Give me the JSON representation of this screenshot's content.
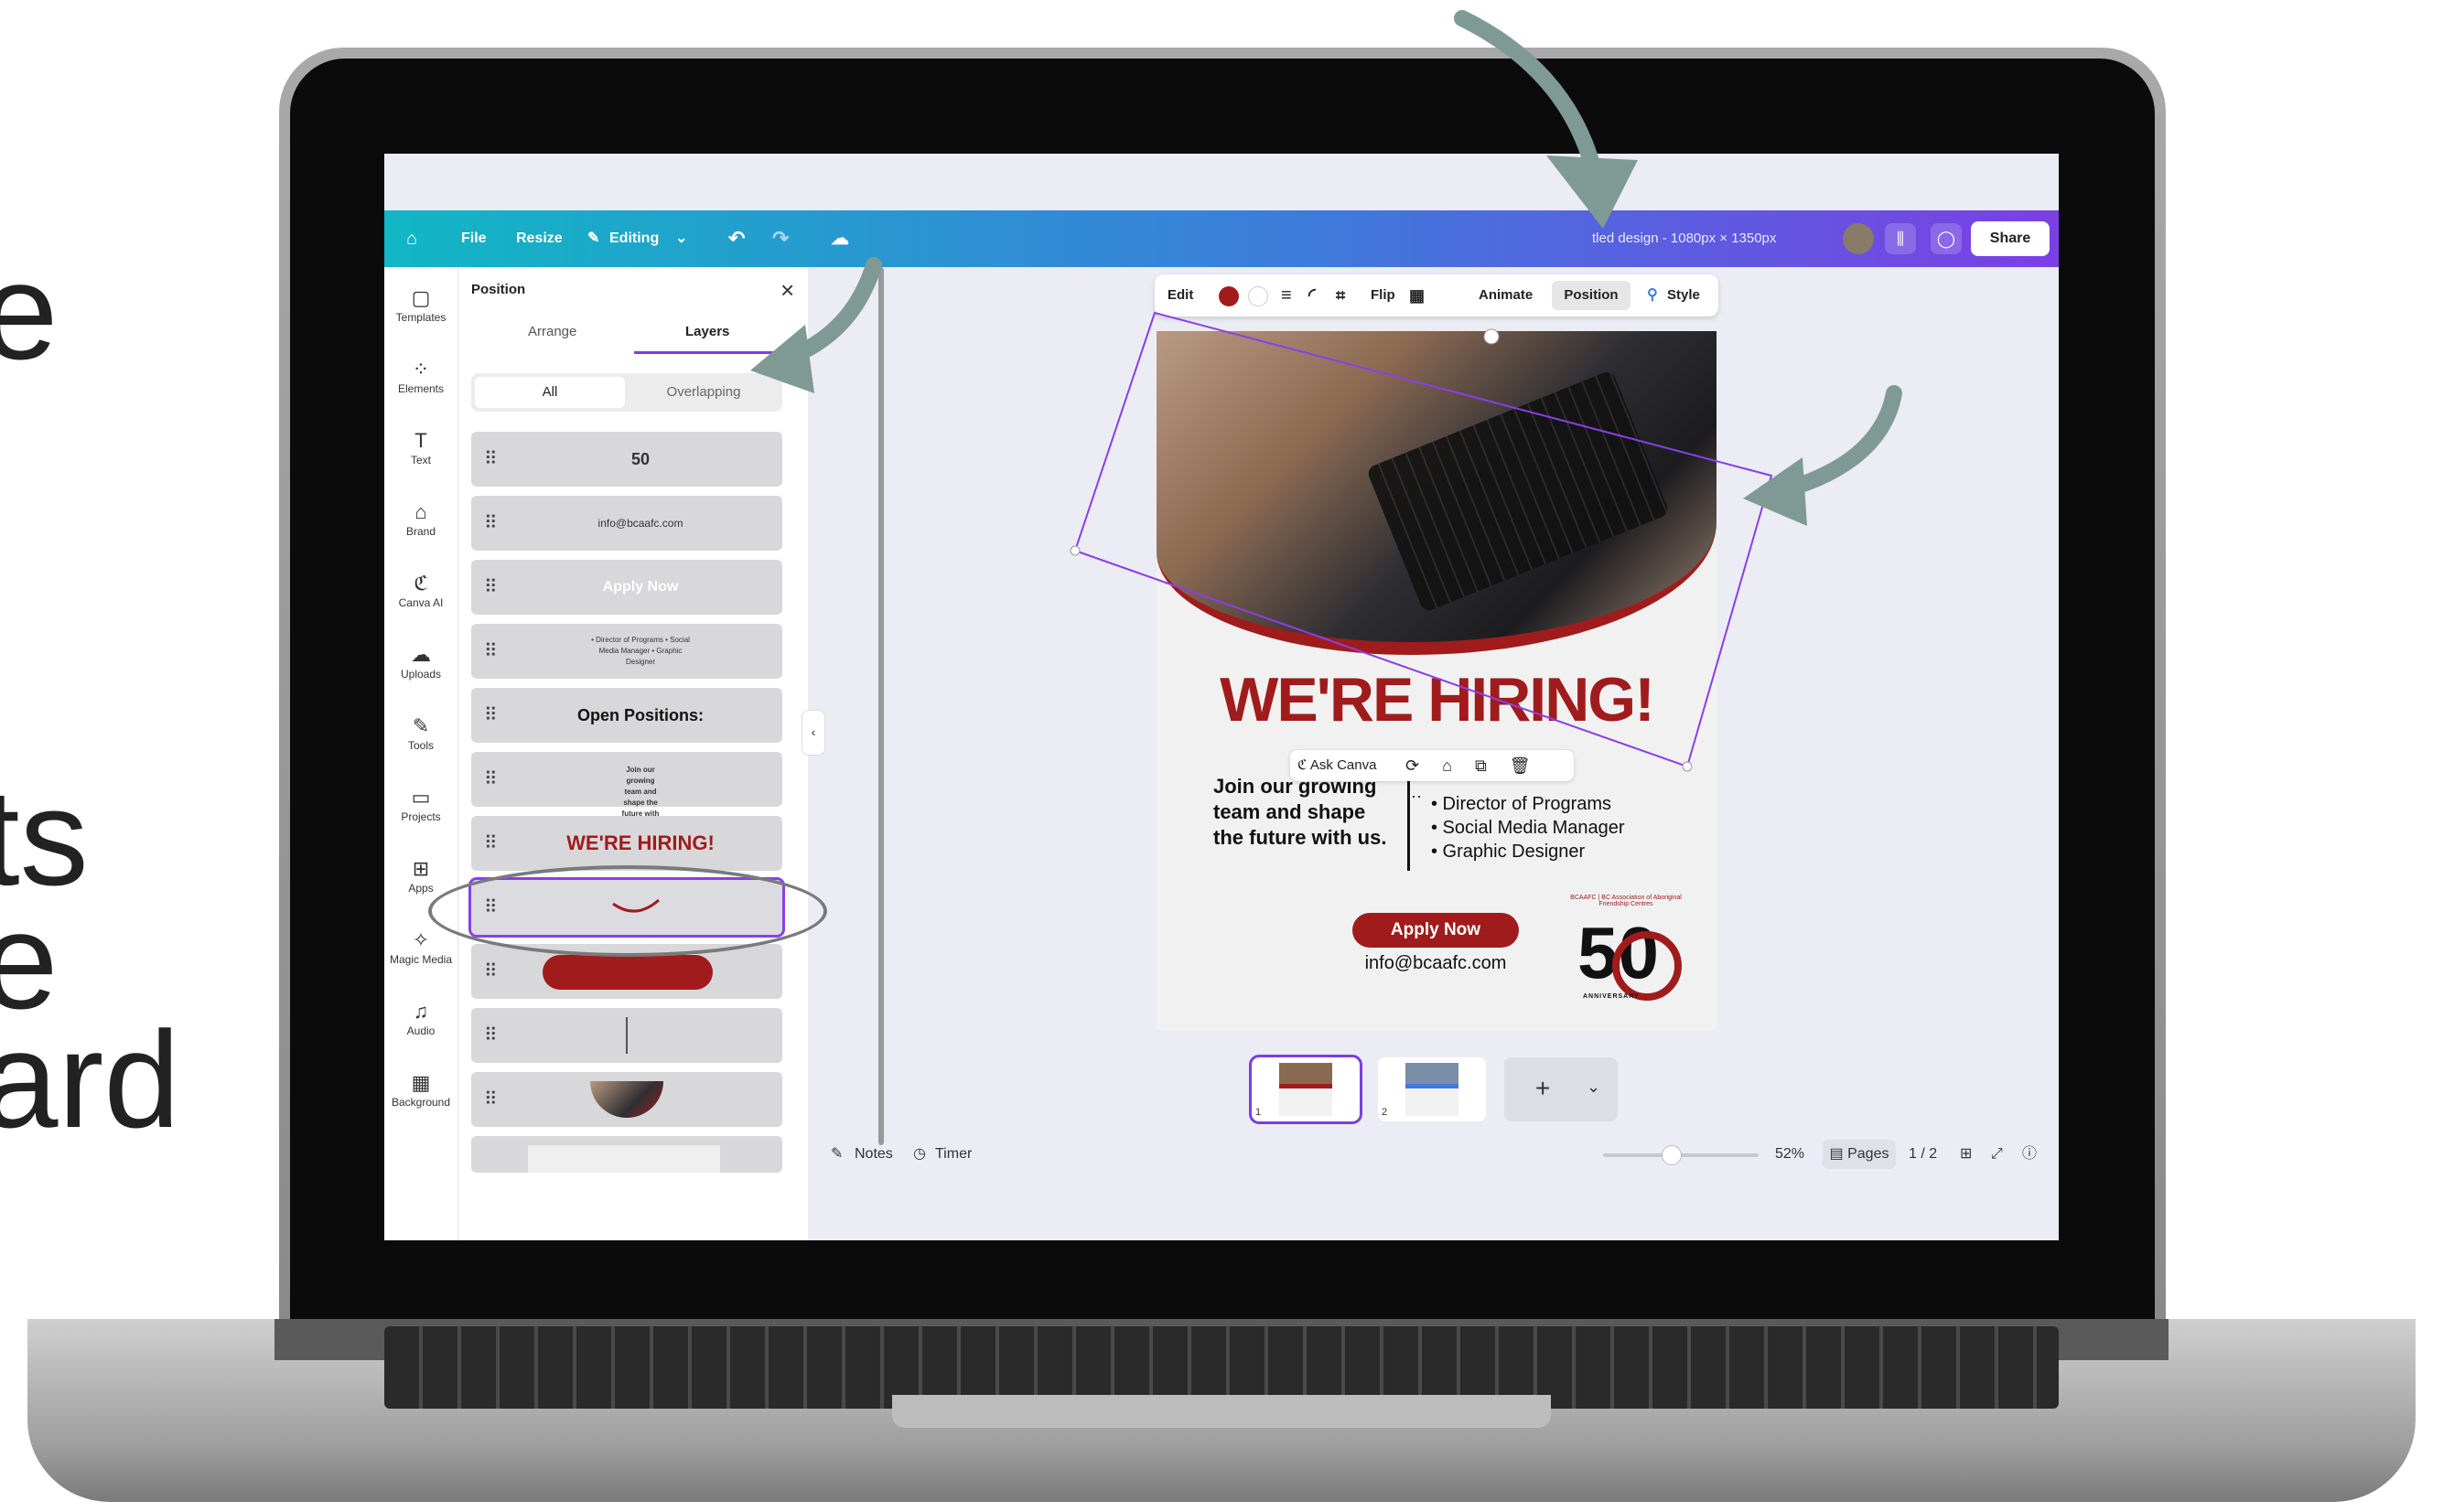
{
  "background_text": [
    "e",
    "ts",
    "e",
    "ard"
  ],
  "topbar": {
    "file": "File",
    "resize": "Resize",
    "editing": "Editing",
    "title": "tled design - 1080px × 1350px",
    "share": "Share"
  },
  "rail": [
    {
      "label": "Templates",
      "icon": "templates-icon",
      "glyph": "▢"
    },
    {
      "label": "Elements",
      "icon": "elements-icon",
      "glyph": "⁘"
    },
    {
      "label": "Text",
      "icon": "text-icon",
      "glyph": "T"
    },
    {
      "label": "Brand",
      "icon": "brand-icon",
      "glyph": "⌂"
    },
    {
      "label": "Canva AI",
      "icon": "canva-ai-icon",
      "glyph": "ℭ"
    },
    {
      "label": "Uploads",
      "icon": "uploads-icon",
      "glyph": "☁"
    },
    {
      "label": "Tools",
      "icon": "tools-icon",
      "glyph": "✎"
    },
    {
      "label": "Projects",
      "icon": "projects-icon",
      "glyph": "▭"
    },
    {
      "label": "Apps",
      "icon": "apps-icon",
      "glyph": "⊞"
    },
    {
      "label": "Magic Media",
      "icon": "magic-media-icon",
      "glyph": "✧"
    },
    {
      "label": "Audio",
      "icon": "audio-icon",
      "glyph": "♫"
    },
    {
      "label": "Background",
      "icon": "background-icon",
      "glyph": "▦"
    }
  ],
  "panel": {
    "title": "Position",
    "tab_arrange": "Arrange",
    "tab_layers": "Layers",
    "filter_all": "All",
    "filter_overlapping": "Overlapping",
    "layers": [
      "50",
      "info@bcaafc.com",
      "Apply Now",
      "• Director of Programs • Social Media Manager • Graphic Designer",
      "Open Positions:",
      "Join our growing team and shape the future with us.",
      "WE'RE HIRING!",
      "",
      "",
      "",
      "",
      ""
    ]
  },
  "context_toolbar": {
    "edit": "Edit",
    "flip": "Flip",
    "animate": "Animate",
    "position": "Position",
    "style": "Style"
  },
  "design": {
    "headline": "WE'RE HIRING!",
    "join_lines": [
      "Join our growing",
      "team and shape",
      "the future with us."
    ],
    "positions": [
      "• Director of Programs",
      "• Social Media Manager",
      "• Graphic Designer"
    ],
    "apply": "Apply Now",
    "email": "info@bcaafc.com",
    "logo_top": "BCAAFC | BC Association of Aboriginal Friendship Centres",
    "logo_number": "50",
    "logo_sub": "ANNIVERSARY"
  },
  "ask_canva": "Ask Canva",
  "pages": {
    "thumb1": "1",
    "thumb2": "2"
  },
  "bottom": {
    "notes": "Notes",
    "timer": "Timer",
    "zoom": "52%",
    "pages": "Pages",
    "page_count": "1 / 2"
  },
  "colors": {
    "accent": "#7b3fe4",
    "brand_red": "#a01c1c",
    "arrow": "#7f9a94"
  }
}
